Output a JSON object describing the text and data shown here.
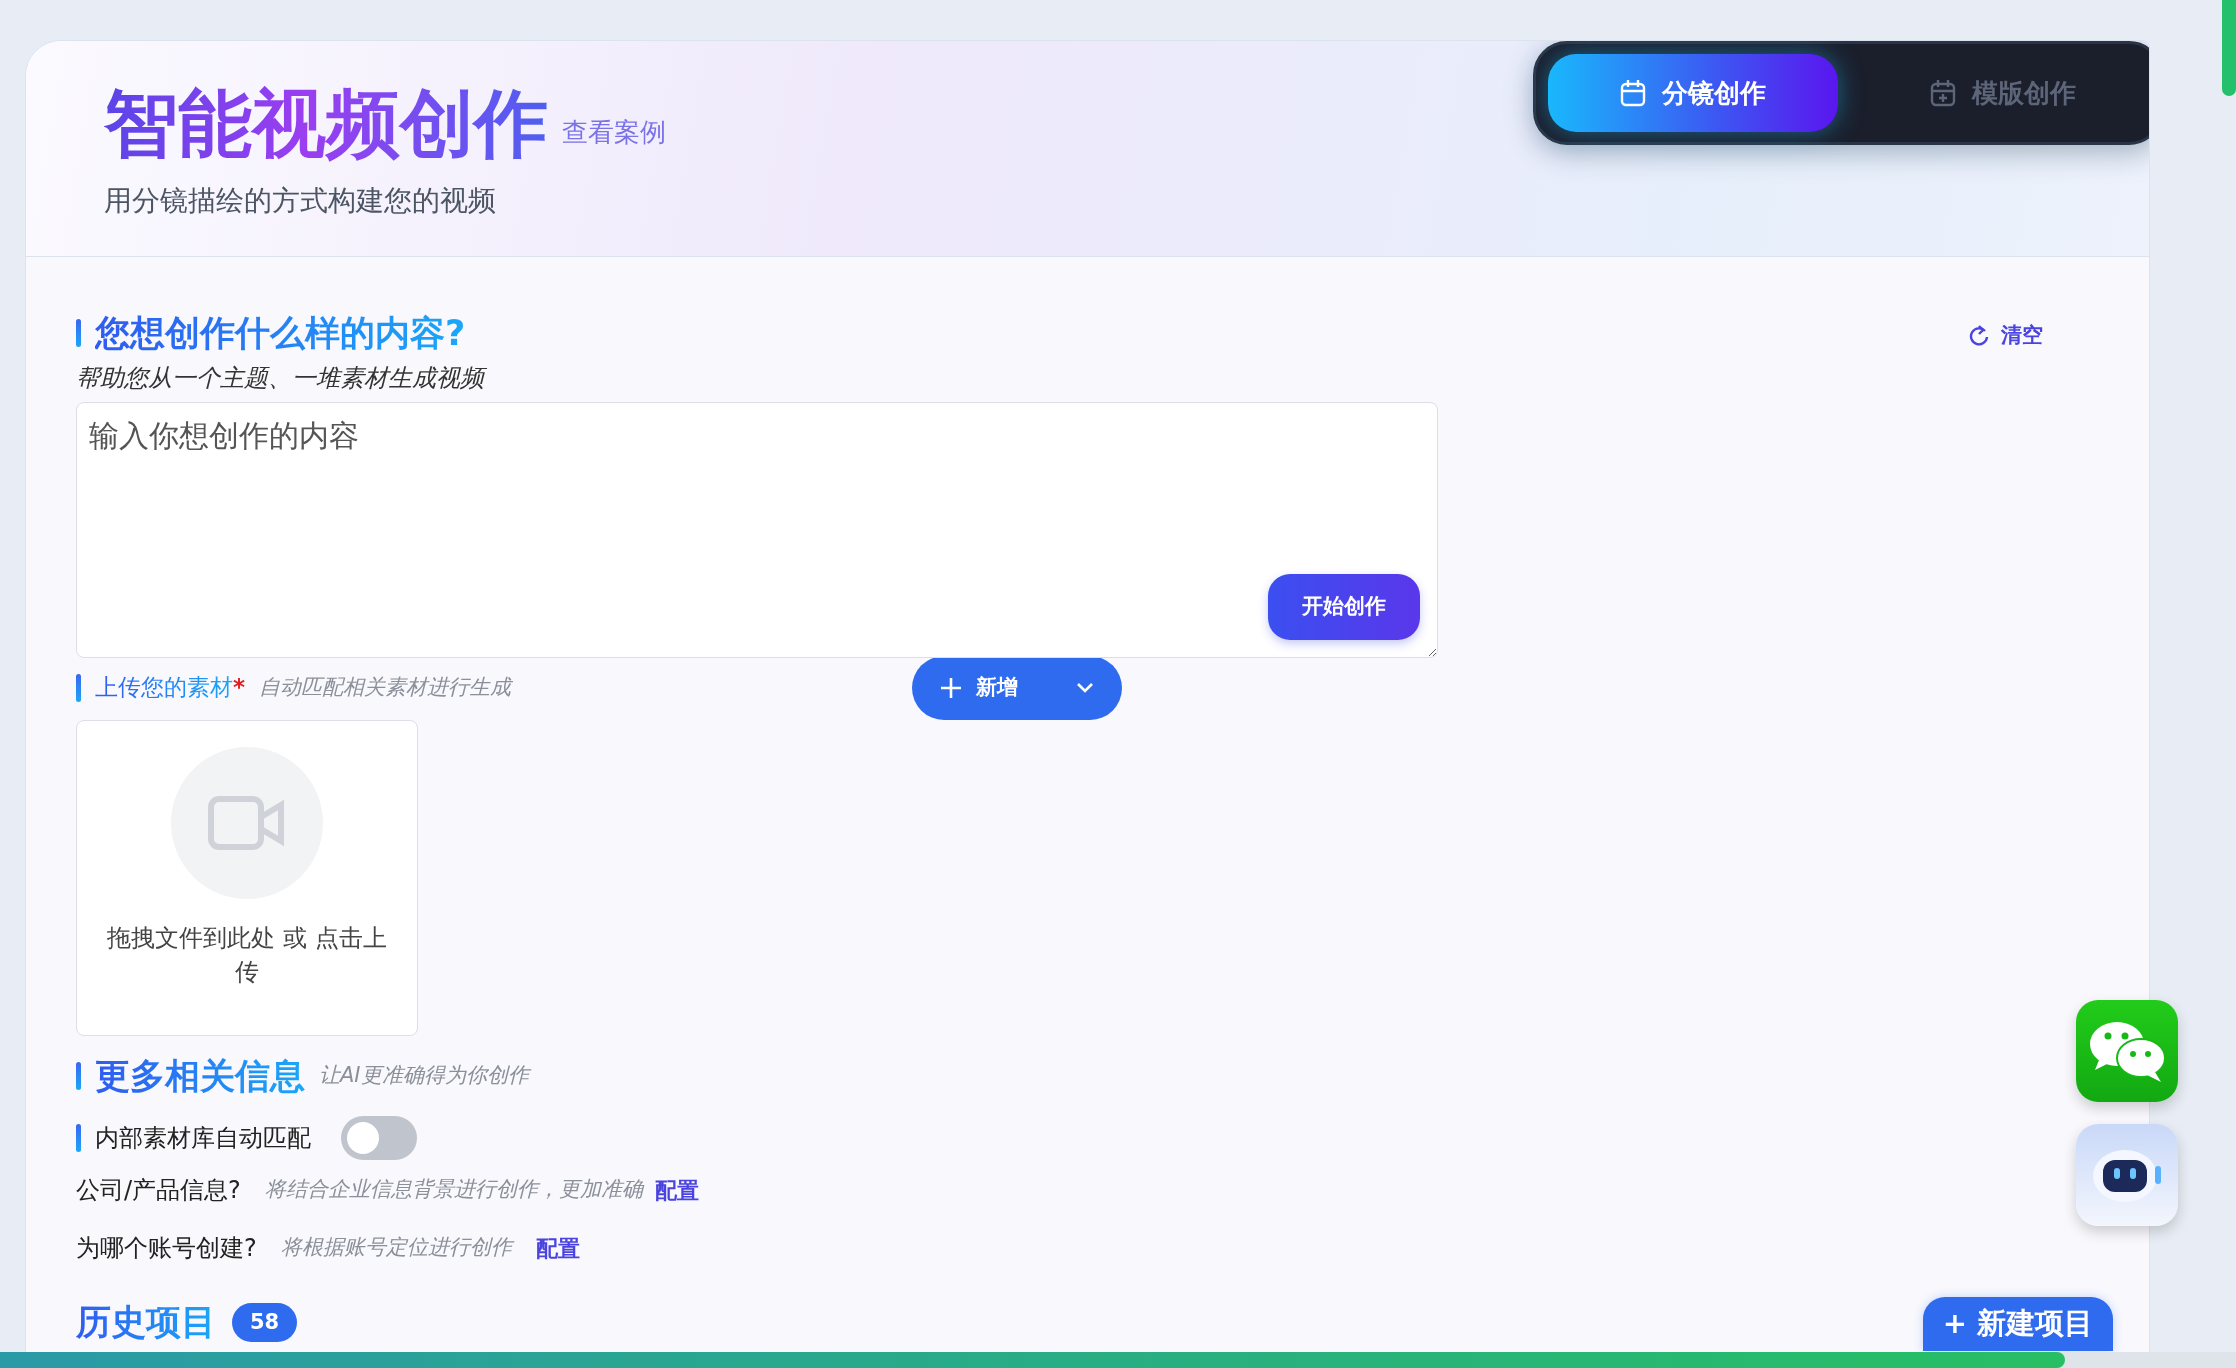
{
  "header": {
    "title": "智能视频创作",
    "examples_link": "查看案例",
    "subtitle": "用分镜描绘的方式构建您的视频"
  },
  "mode_tabs": [
    {
      "label": "分镜创作",
      "selected": true
    },
    {
      "label": "模版创作",
      "selected": false
    }
  ],
  "content_section": {
    "heading": "您想创作什么样的内容?",
    "hint": "帮助您从一个主题、一堆素材生成视频",
    "clear_button": "清空",
    "prompt": {
      "placeholder": "输入你想创作的内容"
    },
    "start_button": "开始创作"
  },
  "upload_section": {
    "heading": "上传您的素材",
    "required_mark": "*",
    "hint": "自动匹配相关素材进行生成",
    "add_button": "新增",
    "dropzone_text": "拖拽文件到此处 或 点击上传"
  },
  "more_info": {
    "heading": "更多相关信息",
    "hint": "让AI更准确得为你创作",
    "auto_match": {
      "label": "内部素材库自动匹配",
      "on": false
    },
    "rows": [
      {
        "label": "公司/产品信息?",
        "hint": "将结合企业信息背景进行创作，更加准确",
        "link": "配置"
      },
      {
        "label": "为哪个账号创建?",
        "hint": "将根据账号定位进行创作",
        "link": "配置"
      }
    ]
  },
  "history": {
    "heading": "历史项目",
    "count": "58",
    "new_button": "+ 新建项目"
  }
}
